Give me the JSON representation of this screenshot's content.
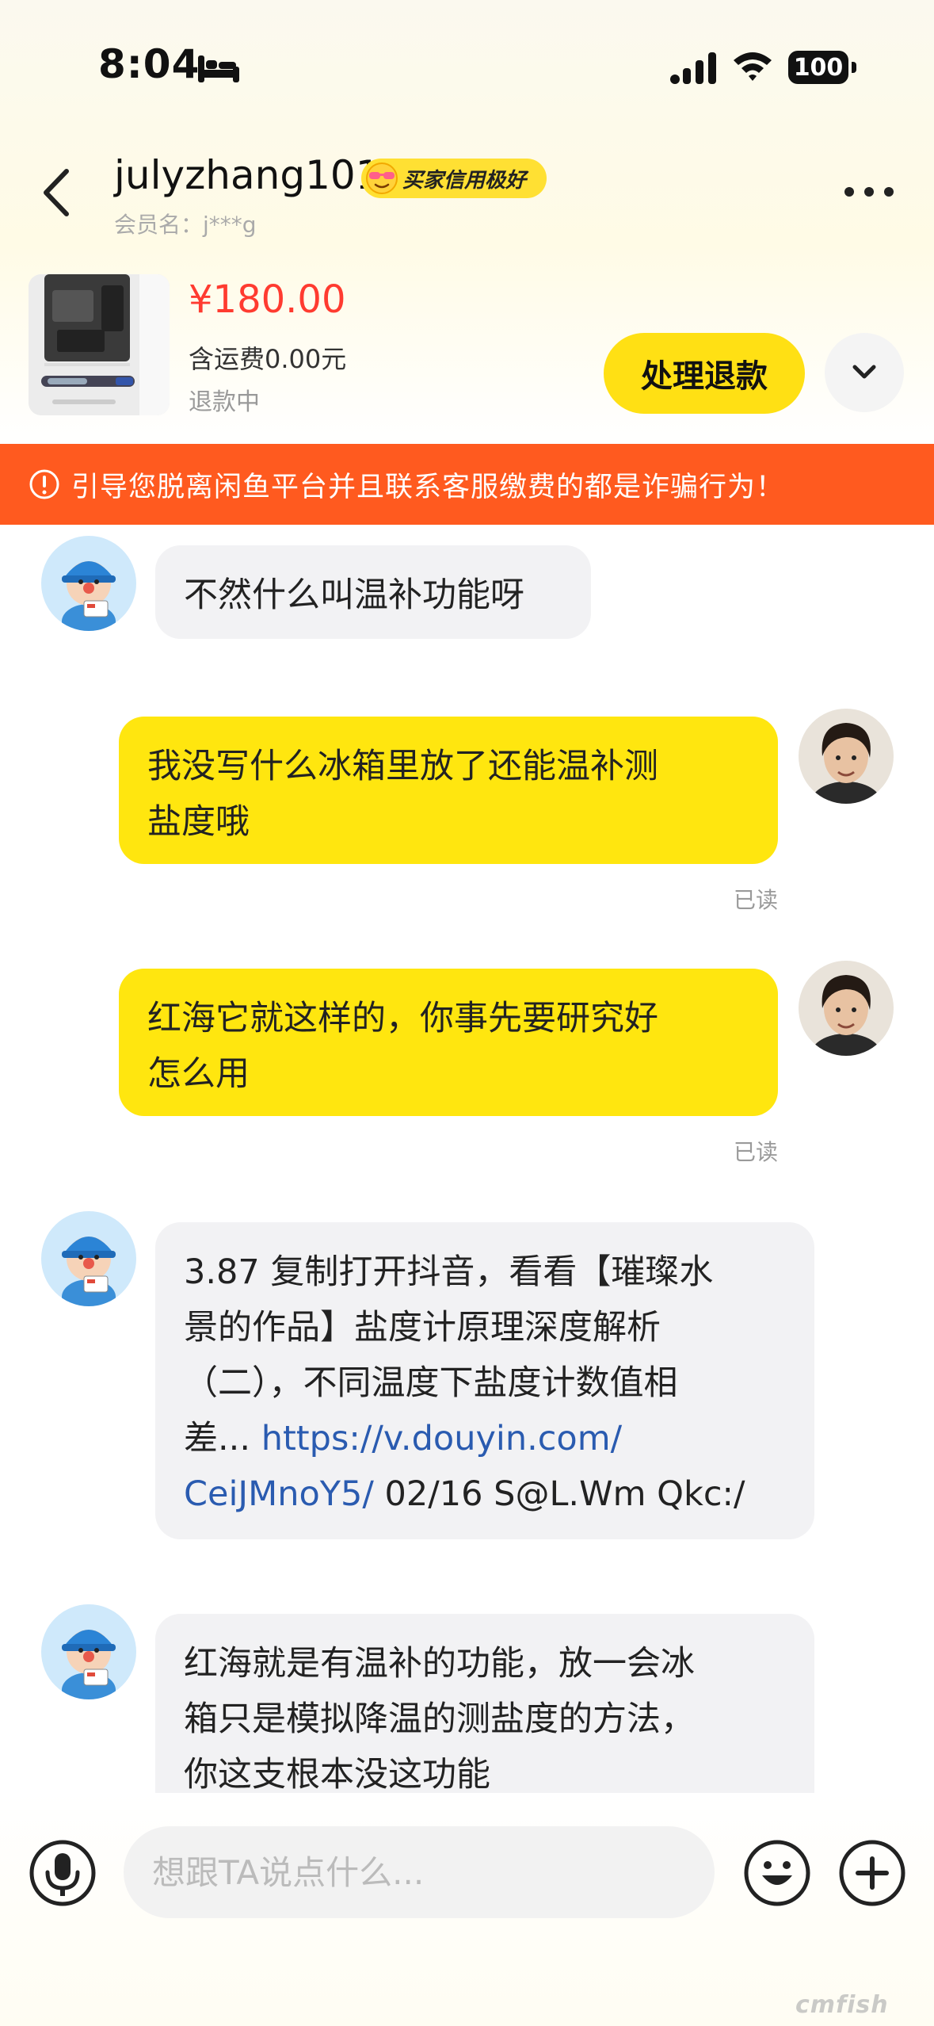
{
  "status_bar": {
    "time": "8:04",
    "battery": "100",
    "icons": [
      "sleep-bed-icon",
      "signal-icon",
      "wifi-icon",
      "battery-icon"
    ]
  },
  "header": {
    "username": "julyzhang101",
    "credit_badge": "买家信用极好",
    "member_label": "会员名：j***g",
    "back_icon": "chevron-left-icon",
    "more_icon": "more-dots-icon"
  },
  "product": {
    "price": "¥180.00",
    "shipping": "含运费0.00元",
    "status": "退款中",
    "refund_button": "处理退款",
    "expand_icon": "chevron-down-icon"
  },
  "warning": {
    "text": "引导您脱离闲鱼平台并且联系客服缴费的都是诈骗行为！",
    "icon": "alert-circle-icon"
  },
  "messages": [
    {
      "side": "in",
      "text": "不然什么叫温补功能呀"
    },
    {
      "side": "out",
      "lines": [
        "我没写什么冰箱里放了还能温补测",
        "盐度哦"
      ],
      "read": "已读"
    },
    {
      "side": "out",
      "lines": [
        "红海它就这样的，你事先要研究好",
        "怎么用"
      ],
      "read": "已读"
    },
    {
      "side": "in",
      "lines": [
        "3.87 复制打开抖音，看看【璀璨水",
        "景的作品】盐度计原理深度解析",
        "（二），不同温度下盐度计数值相"
      ],
      "line4_prefix": "差... ",
      "link_part1": "https://v.douyin.com/",
      "link_part2": "CeiJMnoY5/",
      "line5_suffix": " 02/16 S@L.Wm Qkc:/"
    },
    {
      "side": "in",
      "lines": [
        "红海就是有温补的功能，放一会冰",
        "箱只是模拟降温的测盐度的方法，",
        "你这支根本没这功能"
      ]
    }
  ],
  "input_bar": {
    "placeholder": "想跟TA说点什么...",
    "icons": [
      "microphone-icon",
      "emoji-icon",
      "plus-icon"
    ]
  },
  "watermark": "cmfish"
}
